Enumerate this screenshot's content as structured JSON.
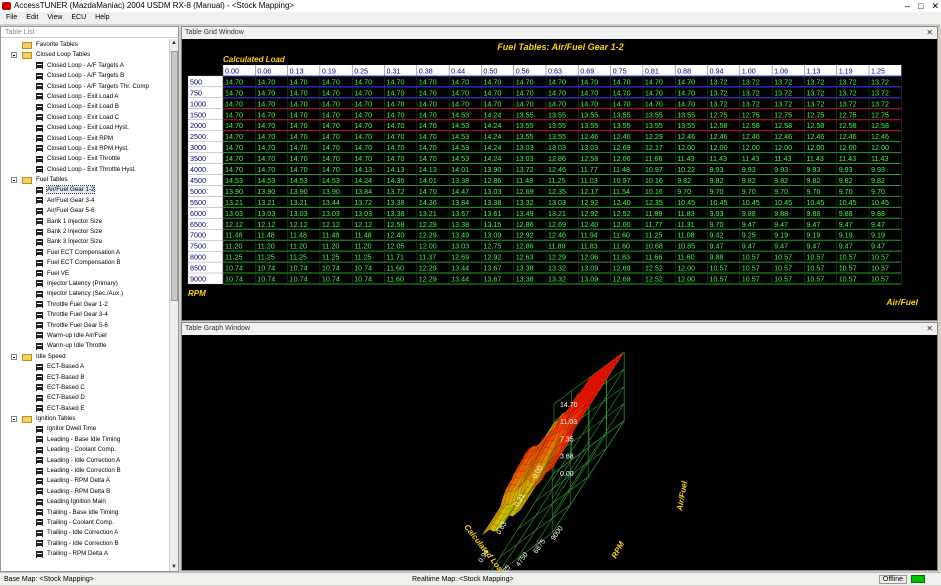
{
  "window": {
    "title": "AccessTUNER  (MazdaManiac) 2004 USDM RX-8 (Manual) - <Stock Mapping>",
    "controls": [
      "–",
      "□",
      "✕"
    ]
  },
  "menu": [
    "File",
    "Edit",
    "View",
    "ECU",
    "Help"
  ],
  "table_list": {
    "header": "Table List",
    "tree": [
      {
        "kind": "folder",
        "label": "Favorite Tables",
        "expand": false
      },
      {
        "kind": "folder",
        "label": "Closed Loop Tables",
        "expand": true
      },
      {
        "kind": "item",
        "label": "Closed Loop - A/F Targets A"
      },
      {
        "kind": "item",
        "label": "Closed Loop - A/F Targets B"
      },
      {
        "kind": "item",
        "label": "Closed Loop - A/F Targets Thr. Comp"
      },
      {
        "kind": "item",
        "label": "Closed Loop - Exit Load A"
      },
      {
        "kind": "item",
        "label": "Closed Loop - Exit Load B"
      },
      {
        "kind": "item",
        "label": "Closed Loop - Exit Load C"
      },
      {
        "kind": "item",
        "label": "Closed Loop - Exit Load Hyst."
      },
      {
        "kind": "item",
        "label": "Closed Loop - Exit RPM"
      },
      {
        "kind": "item",
        "label": "Closed Loop - Exit RPM Hyst."
      },
      {
        "kind": "item",
        "label": "Closed Loop - Exit Throttle"
      },
      {
        "kind": "item",
        "label": "Closed Loop - Exit Throttle Hyst."
      },
      {
        "kind": "folder",
        "label": "Fuel Tables",
        "expand": true
      },
      {
        "kind": "item",
        "label": "Air/Fuel Gear 1-2",
        "selected": true
      },
      {
        "kind": "item",
        "label": "Air/Fuel Gear 3-4"
      },
      {
        "kind": "item",
        "label": "Air/Fuel Gear 5-6"
      },
      {
        "kind": "item",
        "label": "Bank 1 Injector Size"
      },
      {
        "kind": "item",
        "label": "Bank 2 Injector Size"
      },
      {
        "kind": "item",
        "label": "Bank 3 Injector Size"
      },
      {
        "kind": "item",
        "label": "Fuel ECT Compensation A"
      },
      {
        "kind": "item",
        "label": "Fuel ECT Compensation B"
      },
      {
        "kind": "item",
        "label": "Fuel VE"
      },
      {
        "kind": "item",
        "label": "Injector Latency (Primary)"
      },
      {
        "kind": "item",
        "label": "Injector Latency (Sec./Aux.)"
      },
      {
        "kind": "item",
        "label": "Throttle Fuel Gear 1-2"
      },
      {
        "kind": "item",
        "label": "Throttle Fuel Gear 3-4"
      },
      {
        "kind": "item",
        "label": "Throttle Fuel Gear 5-6"
      },
      {
        "kind": "item",
        "label": "Warm-up Idle Air/Fuel"
      },
      {
        "kind": "item",
        "label": "Warm-up Idle Throttle"
      },
      {
        "kind": "folder",
        "label": "Idle Speed",
        "expand": true
      },
      {
        "kind": "item",
        "label": "ECT-Based A"
      },
      {
        "kind": "item",
        "label": "ECT-Based B"
      },
      {
        "kind": "item",
        "label": "ECT-Based C"
      },
      {
        "kind": "item",
        "label": "ECT-Based D"
      },
      {
        "kind": "item",
        "label": "ECT-Based E"
      },
      {
        "kind": "folder",
        "label": "Ignition Tables",
        "expand": true
      },
      {
        "kind": "item",
        "label": "Ignitor Dwell Time"
      },
      {
        "kind": "item",
        "label": "Leading - Base Idle Timing"
      },
      {
        "kind": "item",
        "label": "Leading - Coolant Comp."
      },
      {
        "kind": "item",
        "label": "Leading - Idle Correction A"
      },
      {
        "kind": "item",
        "label": "Leading - Idle Correction B"
      },
      {
        "kind": "item",
        "label": "Leading - RPM Delta A"
      },
      {
        "kind": "item",
        "label": "Leading - RPM Delta B"
      },
      {
        "kind": "item",
        "label": "Leading Ignition Main"
      },
      {
        "kind": "item",
        "label": "Trailing - Base Idle Timing"
      },
      {
        "kind": "item",
        "label": "Trailing - Coolant Comp."
      },
      {
        "kind": "item",
        "label": "Trailing - Idle Correction A"
      },
      {
        "kind": "item",
        "label": "Trailing - Idle Correction B"
      },
      {
        "kind": "item",
        "label": "Trailing - RPM Delta A"
      }
    ]
  },
  "grid_window": {
    "title": "Table Grid Window",
    "close": "✕",
    "table_title": "Fuel Tables: Air/Fuel Gear 1-2",
    "col_axis_label": "Calculated Load",
    "row_axis_label": "RPM",
    "value_label": "Air/Fuel",
    "cols": [
      "0.00",
      "0.06",
      "0.13",
      "0.19",
      "0.25",
      "0.31",
      "0.38",
      "0.44",
      "0.50",
      "0.56",
      "0.63",
      "0.69",
      "0.75",
      "0.81",
      "0.88",
      "0.94",
      "1.00",
      "1.06",
      "1.13",
      "1.19",
      "1.25"
    ],
    "rows": [
      "500",
      "750",
      "1000",
      "1500",
      "2000",
      "2500",
      "3000",
      "3500",
      "4000",
      "4500",
      "5000",
      "5500",
      "6000",
      "6500",
      "7000",
      "7500",
      "8000",
      "8500",
      "9000"
    ],
    "values": [
      [
        "14.70",
        "14.70",
        "14.70",
        "14.70",
        "14.70",
        "14.70",
        "14.70",
        "14.70",
        "14.70",
        "14.70",
        "14.70",
        "14.70",
        "14.70",
        "14.70",
        "14.70",
        "13.72",
        "13.72",
        "13.72",
        "13.72",
        "13.72",
        "13.72"
      ],
      [
        "14.70",
        "14.70",
        "14.70",
        "14.70",
        "14.70",
        "14.70",
        "14.70",
        "14.70",
        "14.70",
        "14.70",
        "14.70",
        "14.70",
        "14.70",
        "14.70",
        "14.70",
        "13.72",
        "13.72",
        "13.72",
        "13.72",
        "13.72",
        "13.72"
      ],
      [
        "14.70",
        "14.70",
        "14.70",
        "14.70",
        "14.70",
        "14.70",
        "14.70",
        "14.70",
        "14.70",
        "14.70",
        "14.70",
        "14.70",
        "14.70",
        "14.70",
        "14.70",
        "13.72",
        "13.72",
        "13.72",
        "13.72",
        "13.72",
        "13.72"
      ],
      [
        "14.70",
        "14.70",
        "14.70",
        "14.70",
        "14.70",
        "14.70",
        "14.70",
        "14.53",
        "14.24",
        "13.55",
        "13.55",
        "13.55",
        "13.55",
        "13.55",
        "13.55",
        "12.75",
        "12.75",
        "12.75",
        "12.75",
        "12.75",
        "12.75"
      ],
      [
        "14.70",
        "14.70",
        "14.70",
        "14.70",
        "14.70",
        "14.70",
        "14.70",
        "14.53",
        "14.24",
        "13.55",
        "13.55",
        "13.55",
        "13.55",
        "13.55",
        "13.55",
        "12.58",
        "12.58",
        "12.58",
        "12.58",
        "12.58",
        "12.58"
      ],
      [
        "14.70",
        "14.70",
        "14.70",
        "14.70",
        "14.70",
        "14.70",
        "14.70",
        "14.53",
        "14.24",
        "13.55",
        "13.55",
        "12.46",
        "12.46",
        "12.29",
        "12.46",
        "12.46",
        "12.46",
        "12.46",
        "12.46",
        "12.46",
        "12.46"
      ],
      [
        "14.70",
        "14.70",
        "14.70",
        "14.70",
        "14.70",
        "14.70",
        "14.70",
        "14.53",
        "14.24",
        "13.03",
        "13.03",
        "13.03",
        "12.69",
        "12.17",
        "12.00",
        "12.00",
        "12.00",
        "12.00",
        "12.00",
        "12.00",
        "12.00"
      ],
      [
        "14.70",
        "14.70",
        "14.70",
        "14.70",
        "14.70",
        "14.70",
        "14.70",
        "14.53",
        "14.24",
        "13.03",
        "12.86",
        "12.58",
        "12.06",
        "11.66",
        "11.43",
        "11.43",
        "11.43",
        "11.43",
        "11.43",
        "11.43",
        "11.43"
      ],
      [
        "14.70",
        "14.70",
        "14.70",
        "14.70",
        "14.13",
        "14.13",
        "14.13",
        "14.01",
        "13.90",
        "13.72",
        "12.46",
        "11.77",
        "11.48",
        "10.97",
        "10.22",
        "9.93",
        "9.93",
        "9.93",
        "9.93",
        "9.93",
        "9.93"
      ],
      [
        "14.53",
        "14.53",
        "14.53",
        "14.53",
        "14.24",
        "14.36",
        "14.01",
        "13.38",
        "12.86",
        "11.48",
        "11.25",
        "11.03",
        "10.97",
        "10.16",
        "9.82",
        "9.82",
        "9.82",
        "9.82",
        "9.82",
        "9.82",
        "9.82"
      ],
      [
        "13.90",
        "13.90",
        "13.90",
        "13.90",
        "13.84",
        "13.72",
        "14.70",
        "14.47",
        "13.03",
        "12.69",
        "12.35",
        "12.17",
        "11.54",
        "10.16",
        "9.70",
        "9.70",
        "9.70",
        "9.70",
        "9.70",
        "9.70",
        "9.70"
      ],
      [
        "13.21",
        "13.21",
        "13.21",
        "13.44",
        "13.72",
        "13.38",
        "14.36",
        "13.84",
        "13.38",
        "13.32",
        "13.03",
        "12.92",
        "12.40",
        "12.35",
        "10.45",
        "10.45",
        "10.45",
        "10.45",
        "10.45",
        "10.45",
        "10.45"
      ],
      [
        "13.03",
        "13.03",
        "13.03",
        "13.03",
        "13.03",
        "13.38",
        "13.21",
        "13.67",
        "13.61",
        "13.49",
        "13.21",
        "12.92",
        "12.52",
        "11.89",
        "11.83",
        "9.93",
        "9.88",
        "9.88",
        "9.88",
        "9.88",
        "9.88"
      ],
      [
        "12.12",
        "12.12",
        "12.12",
        "12.12",
        "12.12",
        "12.58",
        "12.29",
        "13.38",
        "13.15",
        "12.86",
        "12.69",
        "12.40",
        "12.00",
        "11.77",
        "11.31",
        "9.70",
        "9.47",
        "9.47",
        "9.47",
        "9.47",
        "9.47"
      ],
      [
        "11.48",
        "11.48",
        "11.48",
        "11.48",
        "11.48",
        "12.40",
        "12.29",
        "13.49",
        "13.09",
        "12.92",
        "12.46",
        "11.94",
        "11.60",
        "11.25",
        "11.08",
        "9.42",
        "9.25",
        "9.19",
        "9.19",
        "9.19",
        "9.19"
      ],
      [
        "11.20",
        "11.20",
        "11.20",
        "11.20",
        "11.20",
        "12.05",
        "12.00",
        "13.03",
        "12.75",
        "12.86",
        "11.89",
        "11.83",
        "11.60",
        "10.68",
        "10.85",
        "9.47",
        "9.47",
        "9.47",
        "9.47",
        "9.47",
        "9.47"
      ],
      [
        "11.25",
        "11.25",
        "11.25",
        "11.25",
        "11.25",
        "11.71",
        "11.37",
        "12.69",
        "12.92",
        "12.63",
        "12.29",
        "12.06",
        "11.83",
        "11.66",
        "11.60",
        "9.88",
        "10.57",
        "10.57",
        "10.57",
        "10.57",
        "10.57"
      ],
      [
        "10.74",
        "10.74",
        "10.74",
        "10.74",
        "10.74",
        "11.60",
        "12.29",
        "13.44",
        "13.67",
        "13.38",
        "13.32",
        "13.09",
        "12.69",
        "12.52",
        "12.00",
        "10.57",
        "10.57",
        "10.57",
        "10.57",
        "10.57",
        "10.57"
      ],
      [
        "10.74",
        "10.74",
        "10.74",
        "10.74",
        "10.74",
        "11.60",
        "12.29",
        "13.44",
        "13.67",
        "13.38",
        "13.32",
        "13.09",
        "12.69",
        "12.52",
        "12.00",
        "10.57",
        "10.57",
        "10.57",
        "10.57",
        "10.57",
        "10.57"
      ]
    ],
    "colors": {
      "title": "#ffd400",
      "value": "#40ff40",
      "header_bg": "#ffffff",
      "header_text": "#000080"
    }
  },
  "graph_window": {
    "title": "Table Graph Window",
    "close": "✕",
    "z_ticks": [
      "14.70",
      "11.03",
      "7.35",
      "3.68",
      "0.00"
    ],
    "x_ticks": [
      "0.00",
      "0.31",
      "0.63",
      "0.94",
      "1.25"
    ],
    "y_ticks": [
      "500",
      "2625",
      "4750",
      "6875",
      "9000"
    ],
    "x_label": "Calculated Load",
    "y_label": "RPM",
    "z_label": "Air/Fuel"
  },
  "status": {
    "base_map": "Base Map: <Stock Mapping>",
    "realtime_map": "Realtime Map: <Stock Mapping>",
    "connection": "Offline"
  }
}
